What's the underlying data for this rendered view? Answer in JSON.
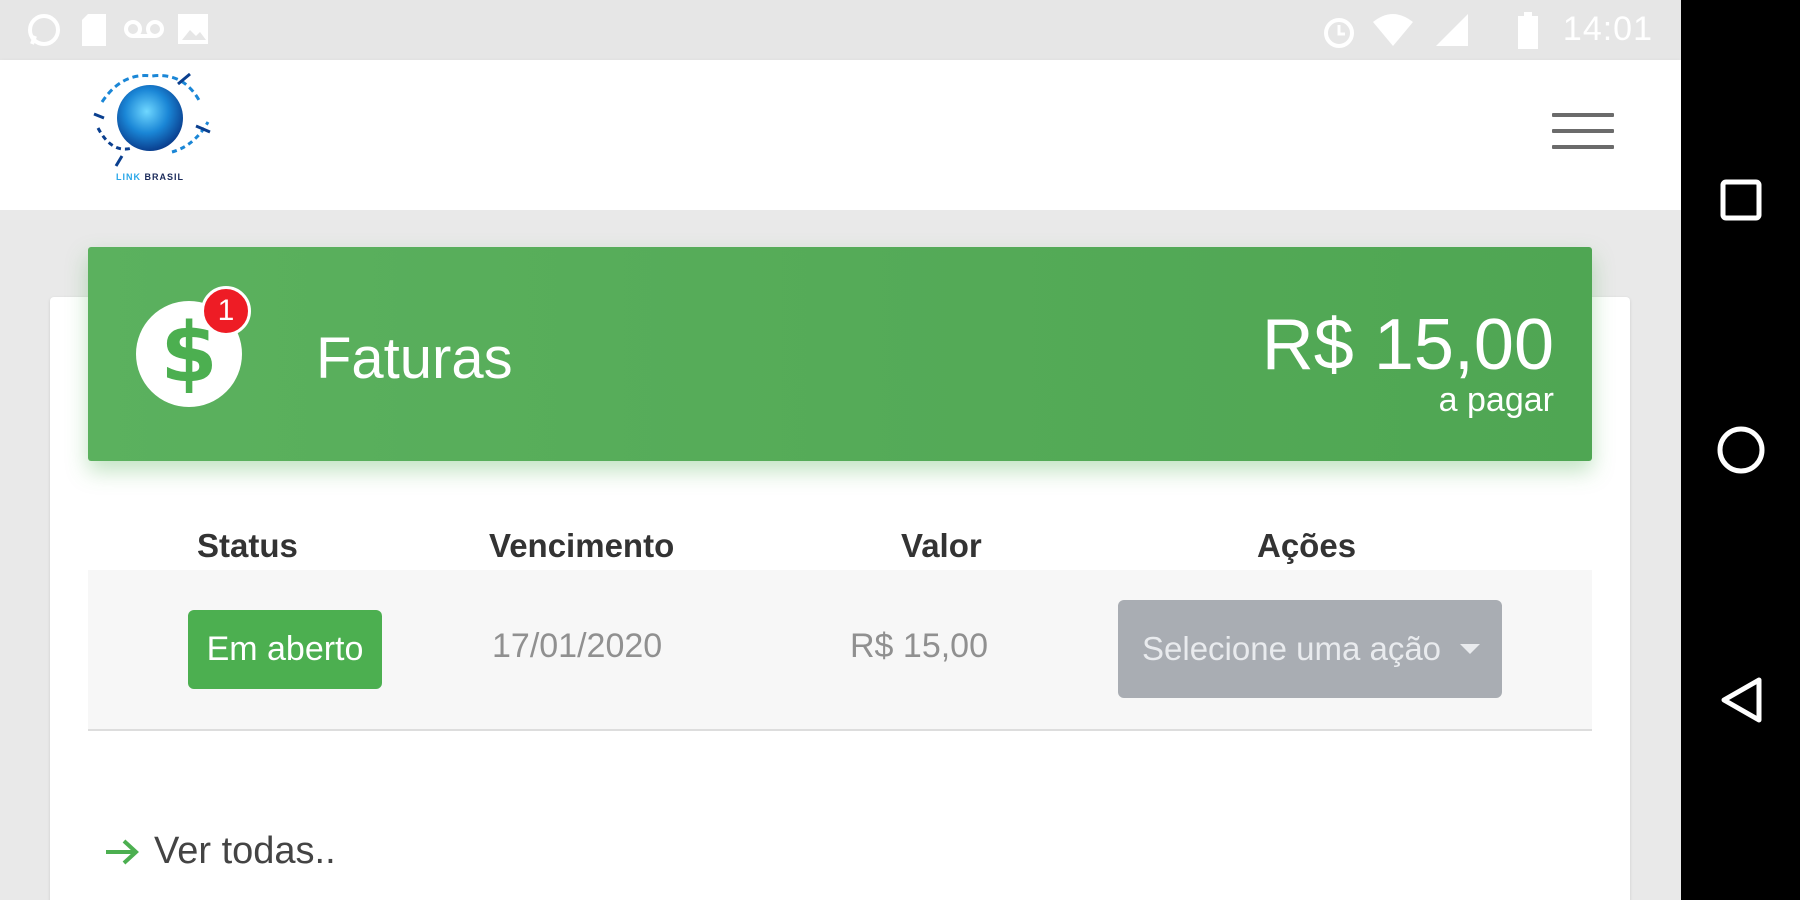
{
  "status_bar": {
    "time": "14:01",
    "icons": [
      "whatsapp-icon",
      "sd-card-icon",
      "voicemail-icon",
      "image-icon",
      "alarm-icon",
      "wifi-icon",
      "signal-icon",
      "battery-icon"
    ]
  },
  "header": {
    "logo_caption": "LINK BRASIL",
    "menu_icon": "hamburger-icon"
  },
  "banner": {
    "icon": "dollar-icon",
    "badge_count": "1",
    "title": "Faturas",
    "amount": "R$ 15,00",
    "amount_caption": "a pagar",
    "color": "#4caf50"
  },
  "table": {
    "headers": [
      "Status",
      "Vencimento",
      "Valor",
      "Ações"
    ],
    "rows": [
      {
        "status": "Em aberto",
        "due_date": "17/01/2020",
        "value": "R$ 15,00",
        "action_placeholder": "Selecione uma ação"
      }
    ]
  },
  "see_all": {
    "label": "Ver todas..",
    "icon": "arrow-right-icon"
  },
  "nav_bar": {
    "buttons": [
      "recents-icon",
      "home-icon",
      "back-icon"
    ]
  },
  "colors": {
    "accent_green": "#4caf50",
    "badge_red": "#ee1c25",
    "select_gray": "#a9adb3"
  }
}
